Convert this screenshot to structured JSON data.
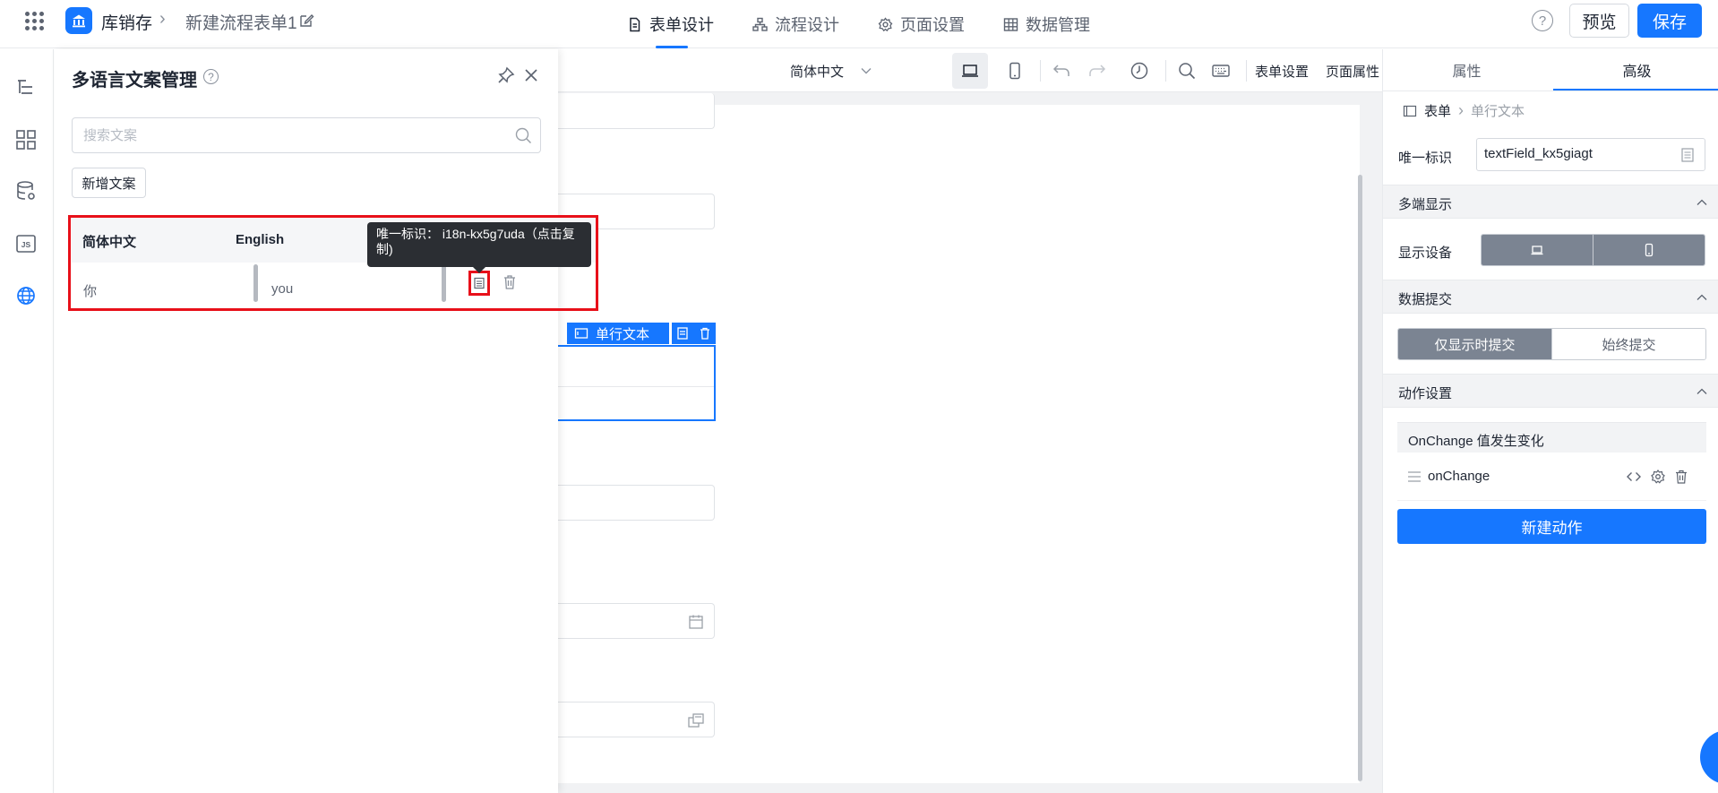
{
  "header": {
    "app_name": "库销存",
    "form_name": "新建流程表单1",
    "tabs": [
      {
        "label": "表单设计",
        "icon": "document-icon",
        "active": true
      },
      {
        "label": "流程设计",
        "icon": "flow-icon",
        "active": false
      },
      {
        "label": "页面设置",
        "icon": "gear-icon",
        "active": false
      },
      {
        "label": "数据管理",
        "icon": "table-icon",
        "active": false
      }
    ],
    "preview_label": "预览",
    "save_label": "保存",
    "accent_color": "#1677ff"
  },
  "toolbar": {
    "language": "简体中文",
    "form_settings": "表单设置",
    "page_properties": "页面属性"
  },
  "i18n_panel": {
    "title": "多语言文案管理",
    "search_placeholder": "搜索文案",
    "add_button": "新增文案",
    "columns": [
      "简体中文",
      "English"
    ],
    "rows": [
      {
        "zh": "你",
        "en": "you"
      }
    ],
    "tooltip": "唯一标识： i18n-kx5g7uda（点击复制)"
  },
  "canvas": {
    "selected_component_label": "单行文本"
  },
  "right_panel": {
    "tabs": [
      {
        "label": "属性",
        "active": false
      },
      {
        "label": "高级",
        "active": true
      }
    ],
    "breadcrumb": {
      "root": "表单",
      "current": "单行文本"
    },
    "unique_id_label": "唯一标识",
    "unique_id_value": "textField_kx5giagt",
    "multi_display": {
      "title": "多端显示",
      "device_label": "显示设备"
    },
    "data_submit": {
      "title": "数据提交",
      "options": [
        "仅显示时提交",
        "始终提交"
      ]
    },
    "action_settings": {
      "title": "动作设置",
      "event_label": "OnChange 值发生变化",
      "handler": "onChange",
      "new_action": "新建动作"
    }
  }
}
